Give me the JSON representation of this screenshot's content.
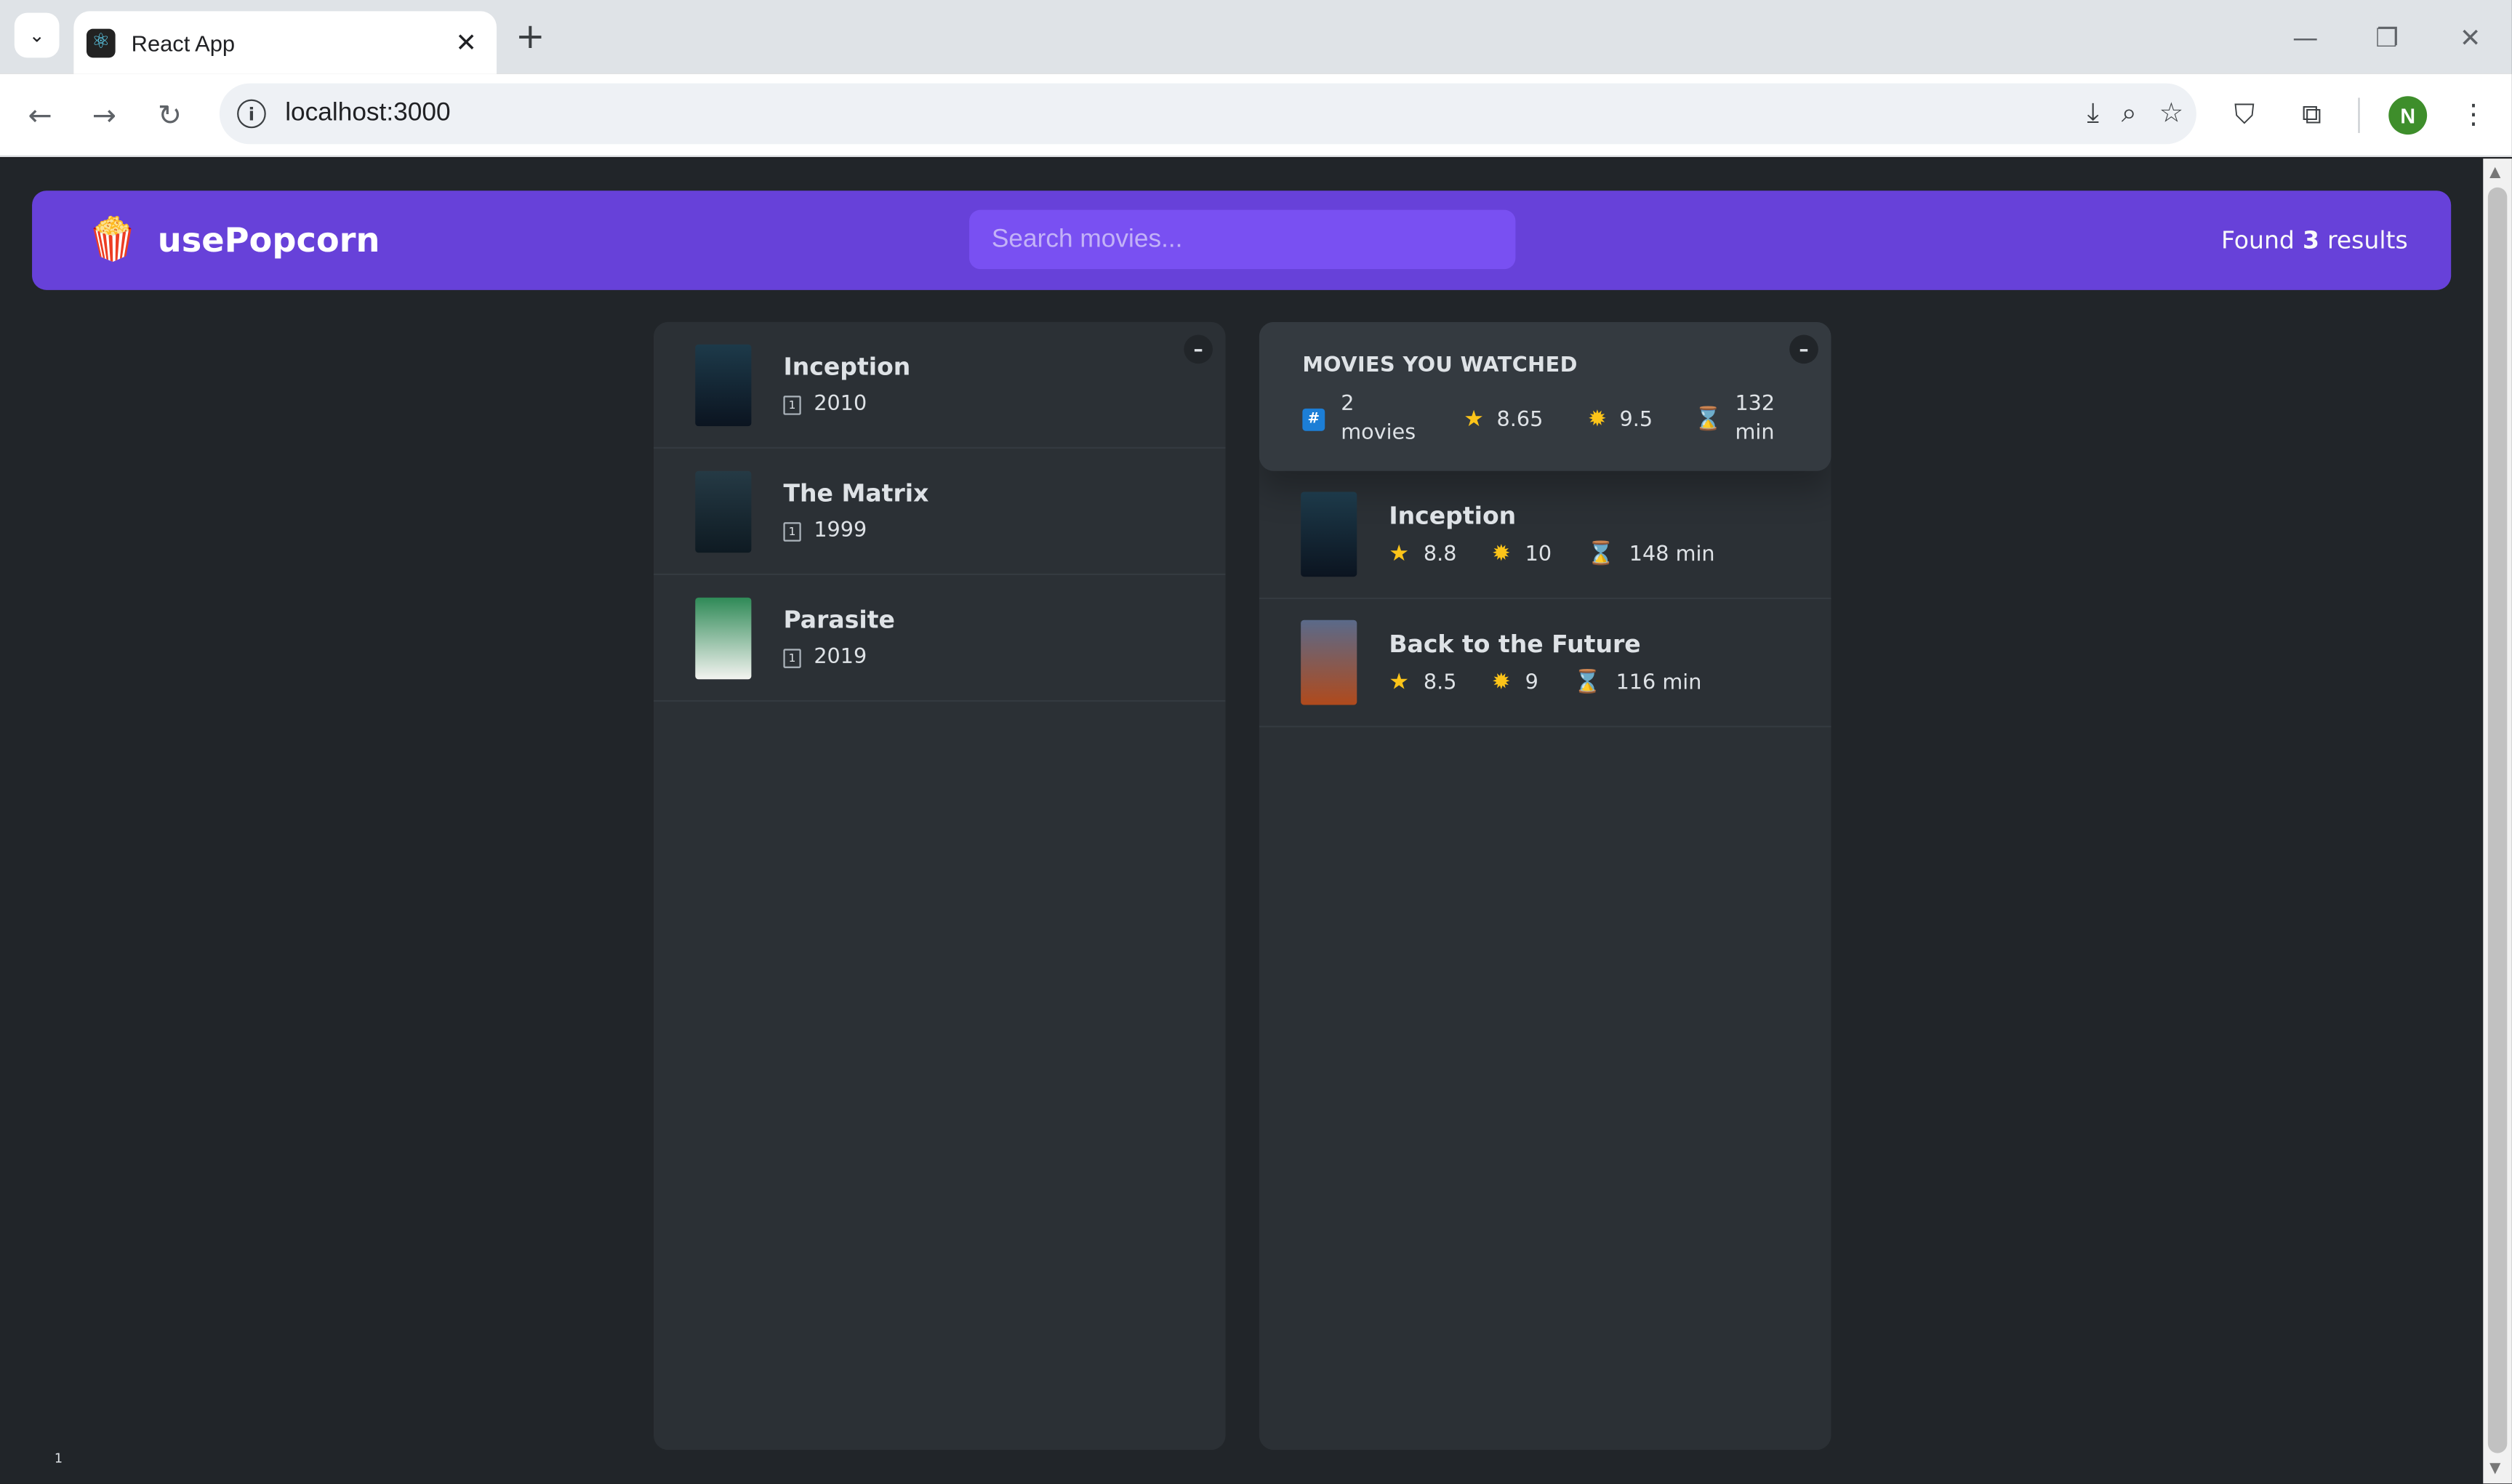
{
  "browser": {
    "tab_title": "React App",
    "tab_favicon": "react-icon",
    "new_tab": "+",
    "url": "localhost:3000",
    "profile_initial": "N"
  },
  "navbar": {
    "logo_emoji": "🍿",
    "logo_text": "usePopcorn",
    "search_placeholder": "Search movies...",
    "results_prefix": "Found",
    "results_count": "3",
    "results_suffix": "results"
  },
  "movie_list": {
    "toggle_label": "–",
    "movies": [
      {
        "title": "Inception",
        "year": "2010",
        "poster_colors": [
          "#1d3a4a",
          "#0b1420"
        ]
      },
      {
        "title": "The Matrix",
        "year": "1999",
        "poster_colors": [
          "#253a45",
          "#0e1a22"
        ]
      },
      {
        "title": "Parasite",
        "year": "2019",
        "poster_colors": [
          "#2f8a57",
          "#f3f3f0"
        ]
      }
    ]
  },
  "watched": {
    "toggle_label": "–",
    "summary_title": "MOVIES YOU WATCHED",
    "summary": {
      "count": "2",
      "count_unit": "movies",
      "avg_imdb": "8.65",
      "avg_user": "9.5",
      "avg_runtime": "132",
      "runtime_unit": "min"
    },
    "movies": [
      {
        "title": "Inception",
        "imdb": "8.8",
        "user": "10",
        "runtime": "148 min",
        "poster_colors": [
          "#1d3a4a",
          "#0b1420"
        ]
      },
      {
        "title": "Back to the Future",
        "imdb": "8.5",
        "user": "9",
        "runtime": "116 min",
        "poster_colors": [
          "#5a6a8a",
          "#b04a1c"
        ]
      }
    ]
  },
  "footer_marker": "1",
  "colors": {
    "primary": "#6741d9",
    "primary_light": "#7950f2",
    "background": "#212529",
    "box": "#2b3035",
    "star": "#fcc419"
  }
}
